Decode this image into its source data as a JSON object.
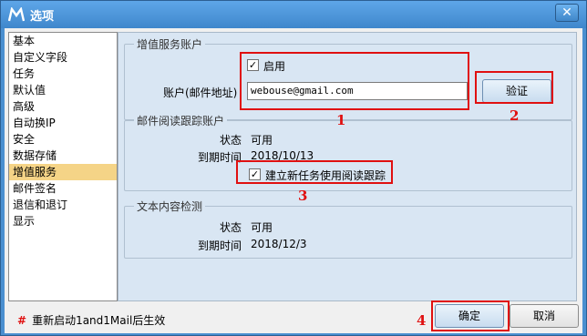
{
  "window": {
    "title": "选项",
    "close_label": "✕"
  },
  "sidebar": {
    "items": [
      {
        "label": "基本"
      },
      {
        "label": "自定义字段"
      },
      {
        "label": "任务"
      },
      {
        "label": "默认值"
      },
      {
        "label": "高级"
      },
      {
        "label": "自动换IP"
      },
      {
        "label": "安全"
      },
      {
        "label": "数据存储"
      },
      {
        "label": "增值服务",
        "selected": true
      },
      {
        "label": "邮件签名"
      },
      {
        "label": "退信和退订"
      },
      {
        "label": "显示"
      }
    ]
  },
  "account_group": {
    "title": "增值服务账户",
    "enable_label": "启用",
    "enable_checked": true,
    "account_label": "账户(邮件地址)",
    "account_value": "webouse@gmail.com",
    "verify_label": "验证"
  },
  "tracking_group": {
    "title": "邮件阅读跟踪账户",
    "status_label": "状态",
    "status_value": "可用",
    "expiry_label": "到期时间",
    "expiry_value": "2018/10/13",
    "new_task_label": "建立新任务使用阅读跟踪",
    "new_task_checked": true
  },
  "content_group": {
    "title": "文本内容检测",
    "status_label": "状态",
    "status_value": "可用",
    "expiry_label": "到期时间",
    "expiry_value": "2018/12/3"
  },
  "annotations": {
    "n1": "1",
    "n2": "2",
    "n3": "3",
    "n4": "4"
  },
  "footer": {
    "note_marker": "#",
    "note": "重新启动1and1Mail后生效",
    "ok_label": "确定",
    "cancel_label": "取消"
  },
  "colors": {
    "titlebar": "#3f87cc",
    "selected_item": "#f5d487",
    "annotation_red": "#e01010"
  }
}
